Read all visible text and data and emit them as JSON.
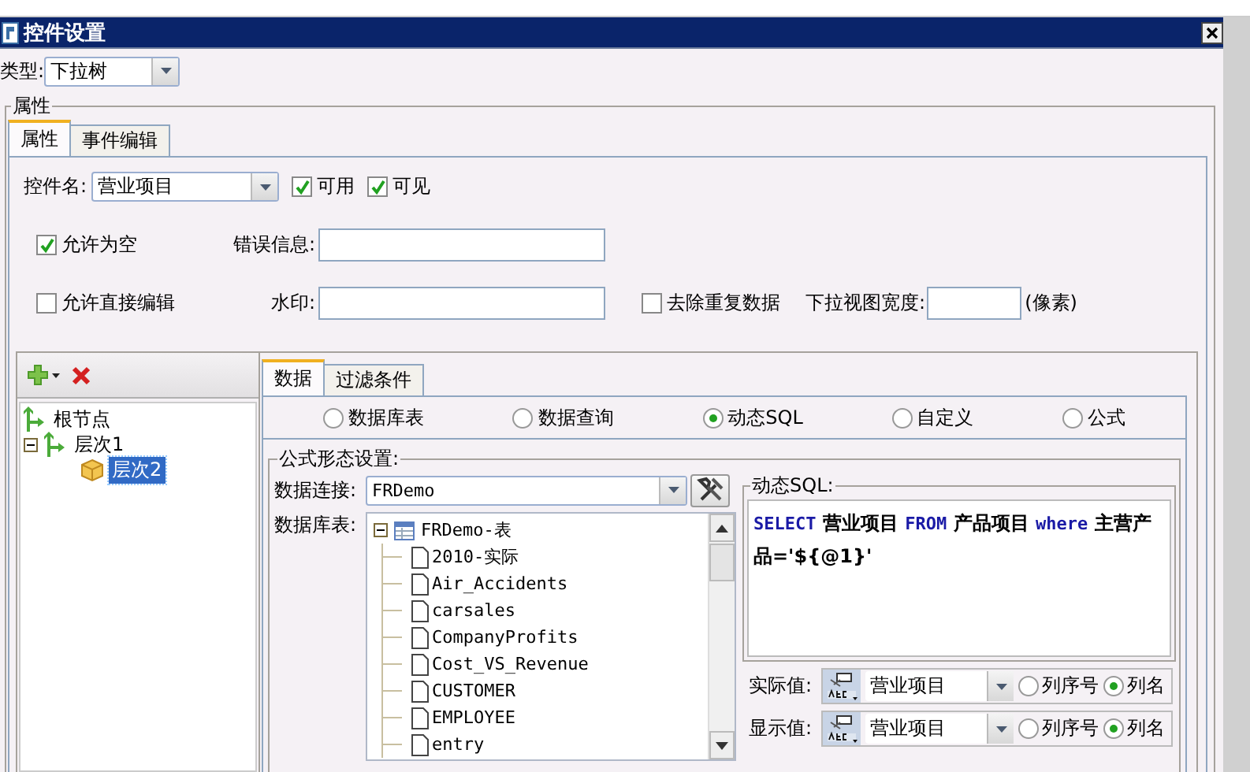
{
  "window": {
    "title": "控件设置"
  },
  "type_field": {
    "label": "类型:",
    "value": "下拉树"
  },
  "properties_group": {
    "title": "属性"
  },
  "tabs": [
    {
      "label": "属性",
      "selected": true
    },
    {
      "label": "事件编辑",
      "selected": false
    }
  ],
  "widget_name": {
    "label": "控件名:",
    "value": "营业项目"
  },
  "widget_flags": [
    {
      "label": "可用",
      "checked": true
    },
    {
      "label": "可见",
      "checked": true
    }
  ],
  "allow_empty": {
    "label": "允许为空",
    "checked": true
  },
  "error_message": {
    "label": "错误信息:"
  },
  "allow_direct_edit": {
    "label": "允许直接编辑",
    "checked": false
  },
  "watermark": {
    "label": "水印:"
  },
  "remove_duplicates": {
    "label": "去除重复数据",
    "checked": false
  },
  "dropdown_width": {
    "label": "下拉视图宽度:",
    "unit": "(像素)"
  },
  "tree": [
    {
      "label": "根节点",
      "kind": "branch",
      "selected": false
    },
    {
      "label": "层次1",
      "kind": "branch",
      "selected": false,
      "expanded": true,
      "children": [
        {
          "label": "层次2",
          "kind": "box",
          "selected": true
        }
      ]
    }
  ],
  "data_tabs": [
    {
      "label": "数据",
      "selected": true
    },
    {
      "label": "过滤条件",
      "selected": false
    }
  ],
  "source_options": [
    {
      "label": "数据库表",
      "selected": false
    },
    {
      "label": "数据查询",
      "selected": false
    },
    {
      "label": "动态SQL",
      "selected": true
    },
    {
      "label": "自定义",
      "selected": false
    },
    {
      "label": "公式",
      "selected": false
    }
  ],
  "formula_group": {
    "title": "公式形态设置:",
    "connection": {
      "label": "数据连接:",
      "value": "FRDemo"
    },
    "tables": {
      "label": "数据库表:",
      "root": "FRDemo-表",
      "expanded": true,
      "items": [
        "2010-实际",
        "Air_Accidents",
        "carsales",
        "CompanyProfits",
        "Cost_VS_Revenue",
        "CUSTOMER",
        "EMPLOYEE",
        "entry"
      ]
    }
  },
  "sql": {
    "title": "动态SQL:",
    "tokens": [
      {
        "kind": "keyword",
        "text": "SELECT"
      },
      {
        "kind": "text",
        "text": " 营业项目 "
      },
      {
        "kind": "keyword",
        "text": "FROM"
      },
      {
        "kind": "text",
        "text": " 产品项目 "
      },
      {
        "kind": "keyword",
        "text": "where"
      },
      {
        "kind": "text",
        "text": " 主营产品='${@1}'"
      }
    ]
  },
  "value_rows": [
    {
      "label": "实际值:",
      "value": "营业项目",
      "options": [
        {
          "label": "列序号",
          "selected": false
        },
        {
          "label": "列名",
          "selected": true
        }
      ]
    },
    {
      "label": "显示值:",
      "value": "营业项目",
      "options": [
        {
          "label": "列序号",
          "selected": false
        },
        {
          "label": "列名",
          "selected": true
        }
      ]
    }
  ]
}
